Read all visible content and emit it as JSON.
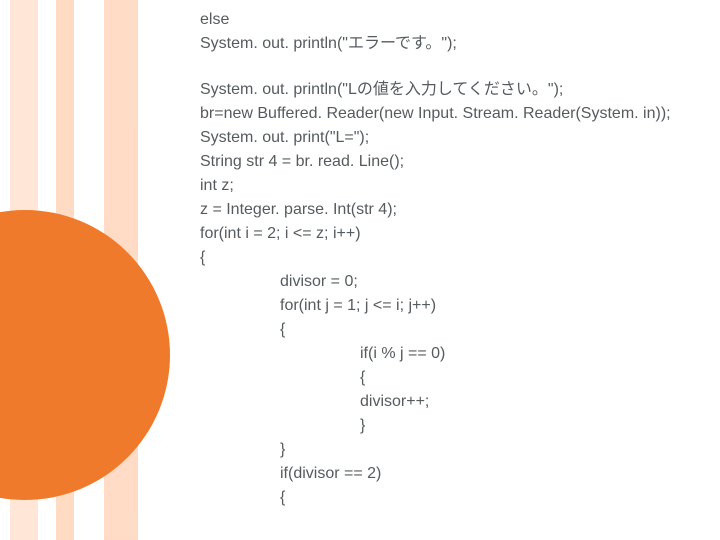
{
  "code": {
    "l01": "else",
    "l02": "System. out. println(\"エラーです。\");",
    "l03": "System. out. println(\"Lの値を入力してください。\");",
    "l04": "br=new Buffered. Reader(new Input. Stream. Reader(System. in));",
    "l05": "System. out. print(\"L=\");",
    "l06": "String str 4 = br. read. Line();",
    "l07": "int z;",
    "l08": "z = Integer. parse. Int(str 4);",
    "l09": "for(int i = 2; i <= z; i++)",
    "l10": "{",
    "l11": "divisor = 0;",
    "l12": "for(int j = 1; j <= i; j++)",
    "l13": "{",
    "l14": "if(i % j == 0)",
    "l15": "{",
    "l16": "divisor++;",
    "l17": "}",
    "l18": "}",
    "l19": "if(divisor == 2)",
    "l20": "{"
  }
}
